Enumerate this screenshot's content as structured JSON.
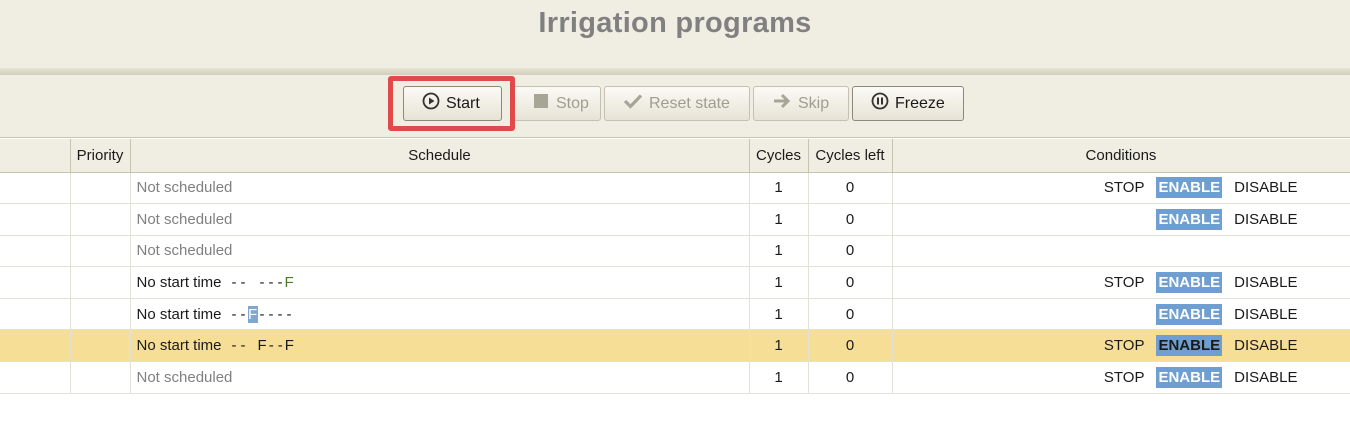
{
  "header": {
    "title": "Irrigation programs"
  },
  "toolbar": {
    "start_label": "Start",
    "stop_label": "Stop",
    "reset_label": "Reset state",
    "skip_label": "Skip",
    "freeze_label": "Freeze"
  },
  "table": {
    "columns": [
      "Priority",
      "Schedule",
      "Cycles",
      "Cycles left",
      "Conditions"
    ],
    "rows": [
      {
        "schedule": "Not scheduled",
        "active": false,
        "days": [],
        "cycles": "1",
        "cycles_left": "0",
        "conditions": [
          "STOP",
          "ENABLE",
          "DISABLE"
        ],
        "selected": false
      },
      {
        "schedule": "Not scheduled",
        "active": false,
        "days": [],
        "cycles": "1",
        "cycles_left": "0",
        "conditions": [
          "ENABLE",
          "DISABLE"
        ],
        "selected": false
      },
      {
        "schedule": "Not scheduled",
        "active": false,
        "days": [],
        "cycles": "1",
        "cycles_left": "0",
        "conditions": [],
        "selected": false
      },
      {
        "schedule": "No start time",
        "active": true,
        "days": [
          "-",
          "-",
          "",
          "-",
          "-",
          "-",
          "F"
        ],
        "cycles": "1",
        "cycles_left": "0",
        "conditions": [
          "STOP",
          "ENABLE",
          "DISABLE"
        ],
        "selected": false
      },
      {
        "schedule": "No start time",
        "active": true,
        "days": [
          "-",
          "-",
          "F",
          "-",
          "-",
          "-",
          "-"
        ],
        "cycles": "1",
        "cycles_left": "0",
        "conditions": [
          "ENABLE",
          "DISABLE"
        ],
        "selected": false
      },
      {
        "schedule": "No start time",
        "active": true,
        "days": [
          "-",
          "-",
          "",
          "F",
          "-",
          "-",
          "F"
        ],
        "cycles": "1",
        "cycles_left": "0",
        "conditions": [
          "STOP",
          "ENABLE",
          "DISABLE"
        ],
        "selected": true
      },
      {
        "schedule": "Not scheduled",
        "active": false,
        "days": [],
        "cycles": "1",
        "cycles_left": "0",
        "conditions": [
          "STOP",
          "ENABLE",
          "DISABLE"
        ],
        "selected": false
      }
    ]
  },
  "icons": {
    "start": "play-circle-icon",
    "stop": "stop-square-icon",
    "reset": "checkmark-icon",
    "skip": "arrow-right-icon",
    "freeze": "pause-circle-icon"
  },
  "colors": {
    "highlight": "#e04a4a",
    "enable_badge": "#6f9fd0",
    "selected_row": "#f7de97"
  }
}
